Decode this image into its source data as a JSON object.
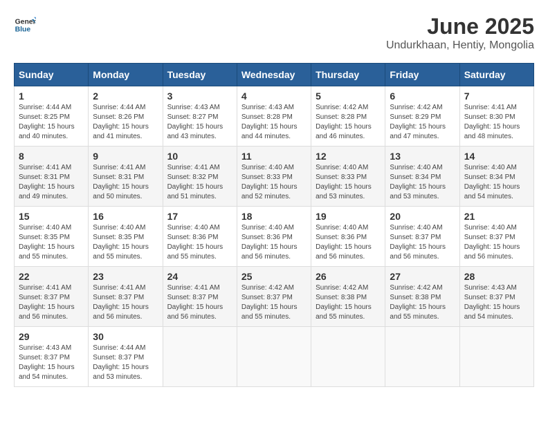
{
  "header": {
    "logo": {
      "general": "General",
      "blue": "Blue"
    },
    "title": "June 2025",
    "subtitle": "Undurkhaan, Hentiy, Mongolia"
  },
  "calendar": {
    "days_of_week": [
      "Sunday",
      "Monday",
      "Tuesday",
      "Wednesday",
      "Thursday",
      "Friday",
      "Saturday"
    ],
    "weeks": [
      [
        null,
        null,
        null,
        null,
        null,
        null,
        null
      ]
    ]
  },
  "cells": {
    "empty": "",
    "days": [
      {
        "date": "1",
        "sunrise": "4:44 AM",
        "sunset": "8:25 PM",
        "daylight": "15 hours and 40 minutes."
      },
      {
        "date": "2",
        "sunrise": "4:44 AM",
        "sunset": "8:26 PM",
        "daylight": "15 hours and 41 minutes."
      },
      {
        "date": "3",
        "sunrise": "4:43 AM",
        "sunset": "8:27 PM",
        "daylight": "15 hours and 43 minutes."
      },
      {
        "date": "4",
        "sunrise": "4:43 AM",
        "sunset": "8:28 PM",
        "daylight": "15 hours and 44 minutes."
      },
      {
        "date": "5",
        "sunrise": "4:42 AM",
        "sunset": "8:28 PM",
        "daylight": "15 hours and 46 minutes."
      },
      {
        "date": "6",
        "sunrise": "4:42 AM",
        "sunset": "8:29 PM",
        "daylight": "15 hours and 47 minutes."
      },
      {
        "date": "7",
        "sunrise": "4:41 AM",
        "sunset": "8:30 PM",
        "daylight": "15 hours and 48 minutes."
      },
      {
        "date": "8",
        "sunrise": "4:41 AM",
        "sunset": "8:31 PM",
        "daylight": "15 hours and 49 minutes."
      },
      {
        "date": "9",
        "sunrise": "4:41 AM",
        "sunset": "8:31 PM",
        "daylight": "15 hours and 50 minutes."
      },
      {
        "date": "10",
        "sunrise": "4:41 AM",
        "sunset": "8:32 PM",
        "daylight": "15 hours and 51 minutes."
      },
      {
        "date": "11",
        "sunrise": "4:40 AM",
        "sunset": "8:33 PM",
        "daylight": "15 hours and 52 minutes."
      },
      {
        "date": "12",
        "sunrise": "4:40 AM",
        "sunset": "8:33 PM",
        "daylight": "15 hours and 53 minutes."
      },
      {
        "date": "13",
        "sunrise": "4:40 AM",
        "sunset": "8:34 PM",
        "daylight": "15 hours and 53 minutes."
      },
      {
        "date": "14",
        "sunrise": "4:40 AM",
        "sunset": "8:34 PM",
        "daylight": "15 hours and 54 minutes."
      },
      {
        "date": "15",
        "sunrise": "4:40 AM",
        "sunset": "8:35 PM",
        "daylight": "15 hours and 55 minutes."
      },
      {
        "date": "16",
        "sunrise": "4:40 AM",
        "sunset": "8:35 PM",
        "daylight": "15 hours and 55 minutes."
      },
      {
        "date": "17",
        "sunrise": "4:40 AM",
        "sunset": "8:36 PM",
        "daylight": "15 hours and 55 minutes."
      },
      {
        "date": "18",
        "sunrise": "4:40 AM",
        "sunset": "8:36 PM",
        "daylight": "15 hours and 56 minutes."
      },
      {
        "date": "19",
        "sunrise": "4:40 AM",
        "sunset": "8:36 PM",
        "daylight": "15 hours and 56 minutes."
      },
      {
        "date": "20",
        "sunrise": "4:40 AM",
        "sunset": "8:37 PM",
        "daylight": "15 hours and 56 minutes."
      },
      {
        "date": "21",
        "sunrise": "4:40 AM",
        "sunset": "8:37 PM",
        "daylight": "15 hours and 56 minutes."
      },
      {
        "date": "22",
        "sunrise": "4:41 AM",
        "sunset": "8:37 PM",
        "daylight": "15 hours and 56 minutes."
      },
      {
        "date": "23",
        "sunrise": "4:41 AM",
        "sunset": "8:37 PM",
        "daylight": "15 hours and 56 minutes."
      },
      {
        "date": "24",
        "sunrise": "4:41 AM",
        "sunset": "8:37 PM",
        "daylight": "15 hours and 56 minutes."
      },
      {
        "date": "25",
        "sunrise": "4:42 AM",
        "sunset": "8:37 PM",
        "daylight": "15 hours and 55 minutes."
      },
      {
        "date": "26",
        "sunrise": "4:42 AM",
        "sunset": "8:38 PM",
        "daylight": "15 hours and 55 minutes."
      },
      {
        "date": "27",
        "sunrise": "4:42 AM",
        "sunset": "8:38 PM",
        "daylight": "15 hours and 55 minutes."
      },
      {
        "date": "28",
        "sunrise": "4:43 AM",
        "sunset": "8:37 PM",
        "daylight": "15 hours and 54 minutes."
      },
      {
        "date": "29",
        "sunrise": "4:43 AM",
        "sunset": "8:37 PM",
        "daylight": "15 hours and 54 minutes."
      },
      {
        "date": "30",
        "sunrise": "4:44 AM",
        "sunset": "8:37 PM",
        "daylight": "15 hours and 53 minutes."
      }
    ]
  }
}
